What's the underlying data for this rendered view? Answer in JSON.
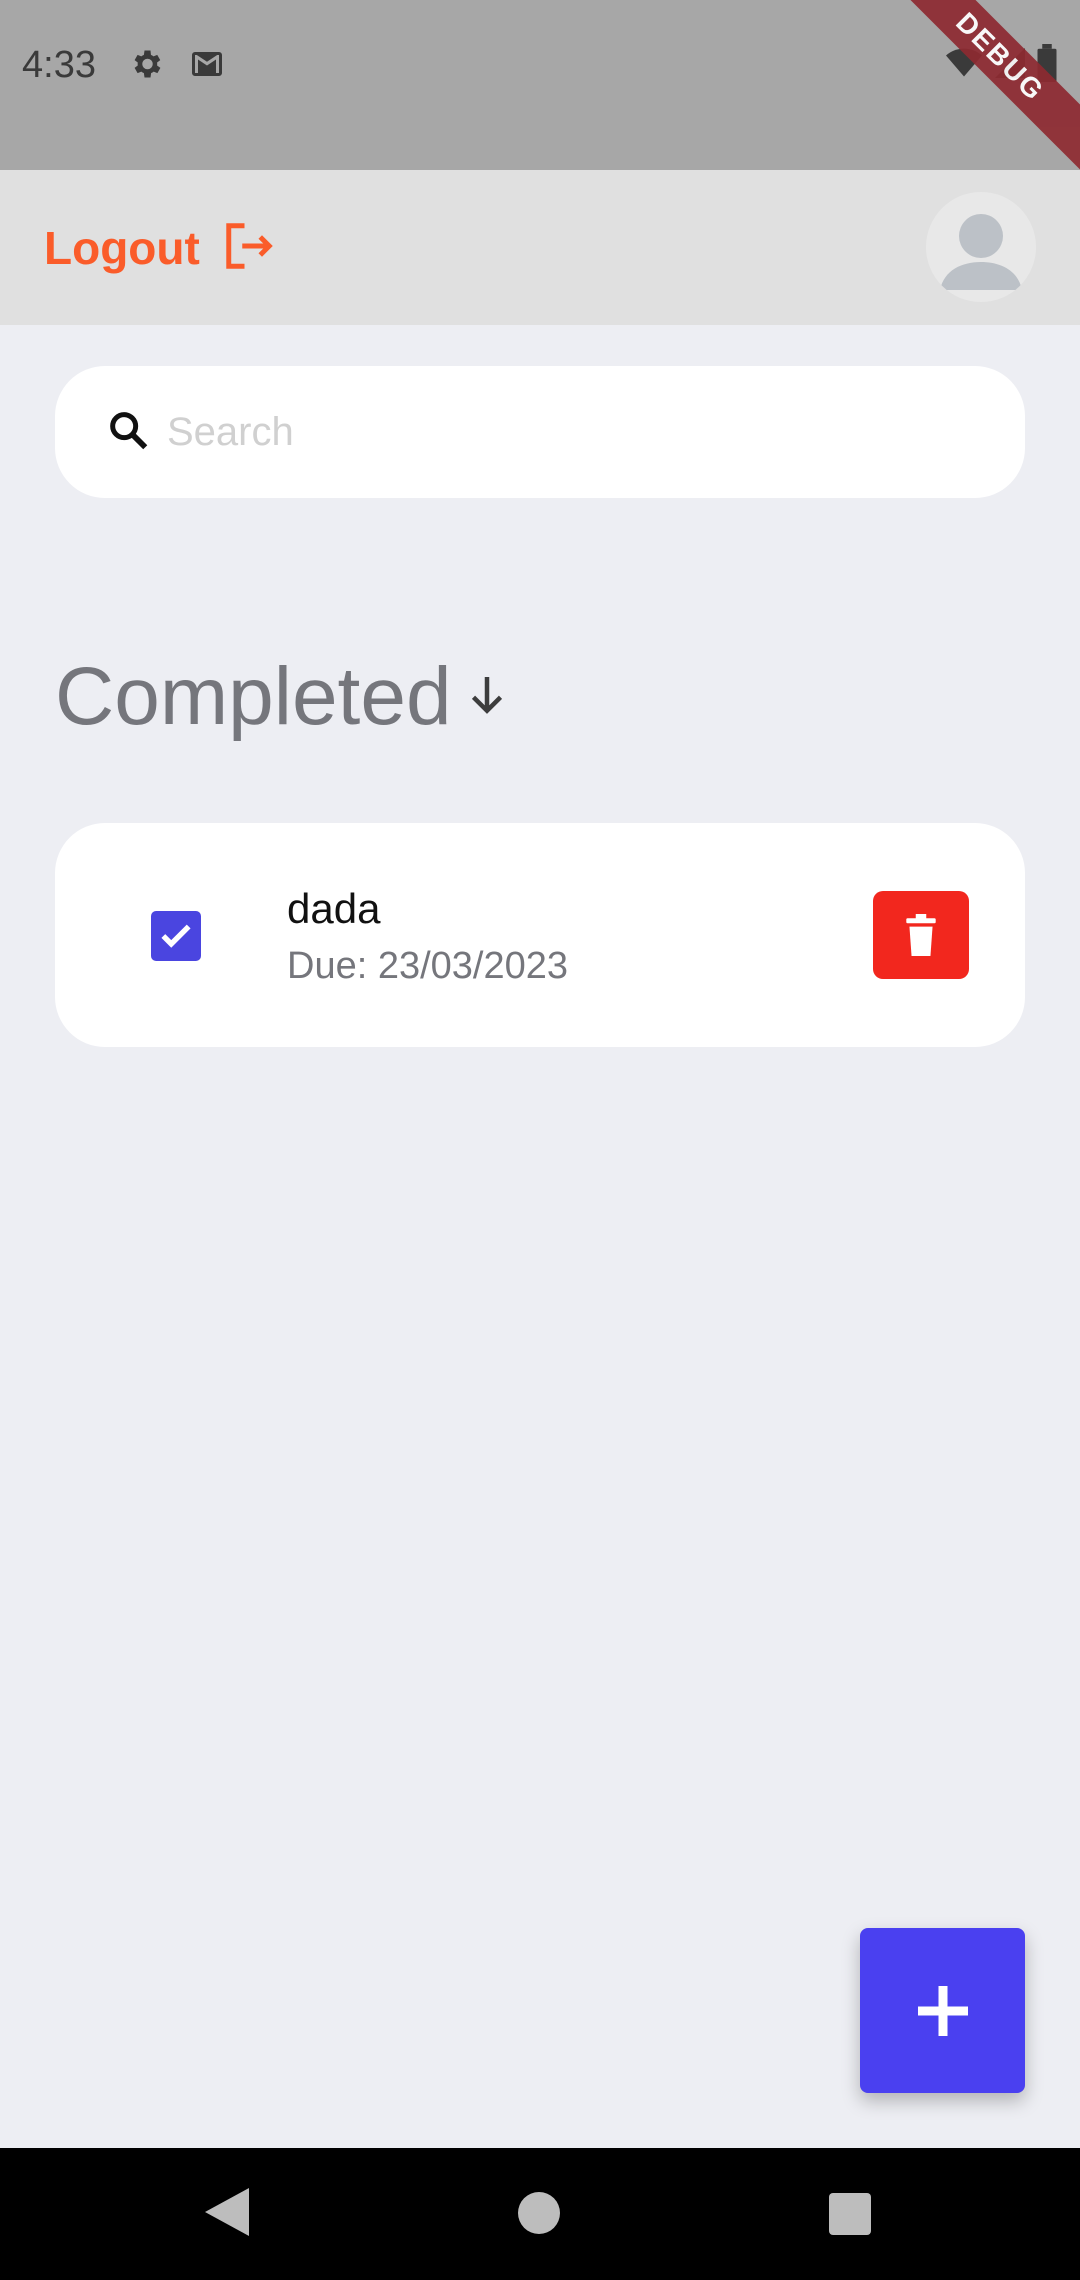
{
  "status_bar": {
    "time": "4:33",
    "icons": [
      "settings-icon",
      "gmail-icon",
      "wifi-icon",
      "signal-icon",
      "battery-icon"
    ],
    "debug_banner": "DEBUG"
  },
  "app_bar": {
    "logout_label": "Logout",
    "logout_icon": "logout-icon",
    "avatar_icon": "person-icon"
  },
  "search": {
    "placeholder": "Search",
    "value": ""
  },
  "section": {
    "title": "Completed",
    "icon": "arrow-down-icon"
  },
  "tasks": [
    {
      "title": "dada",
      "due": "Due: 23/03/2023",
      "completed": true,
      "delete_icon": "trash-icon"
    }
  ],
  "fab": {
    "icon": "plus-icon"
  },
  "colors": {
    "accent": "#4a40f0",
    "logout": "#fa5c2a",
    "delete": "#f2271e",
    "background": "#edeef3",
    "app_bar": "#e0e0e0",
    "status_bar": "#a7a7a7"
  }
}
